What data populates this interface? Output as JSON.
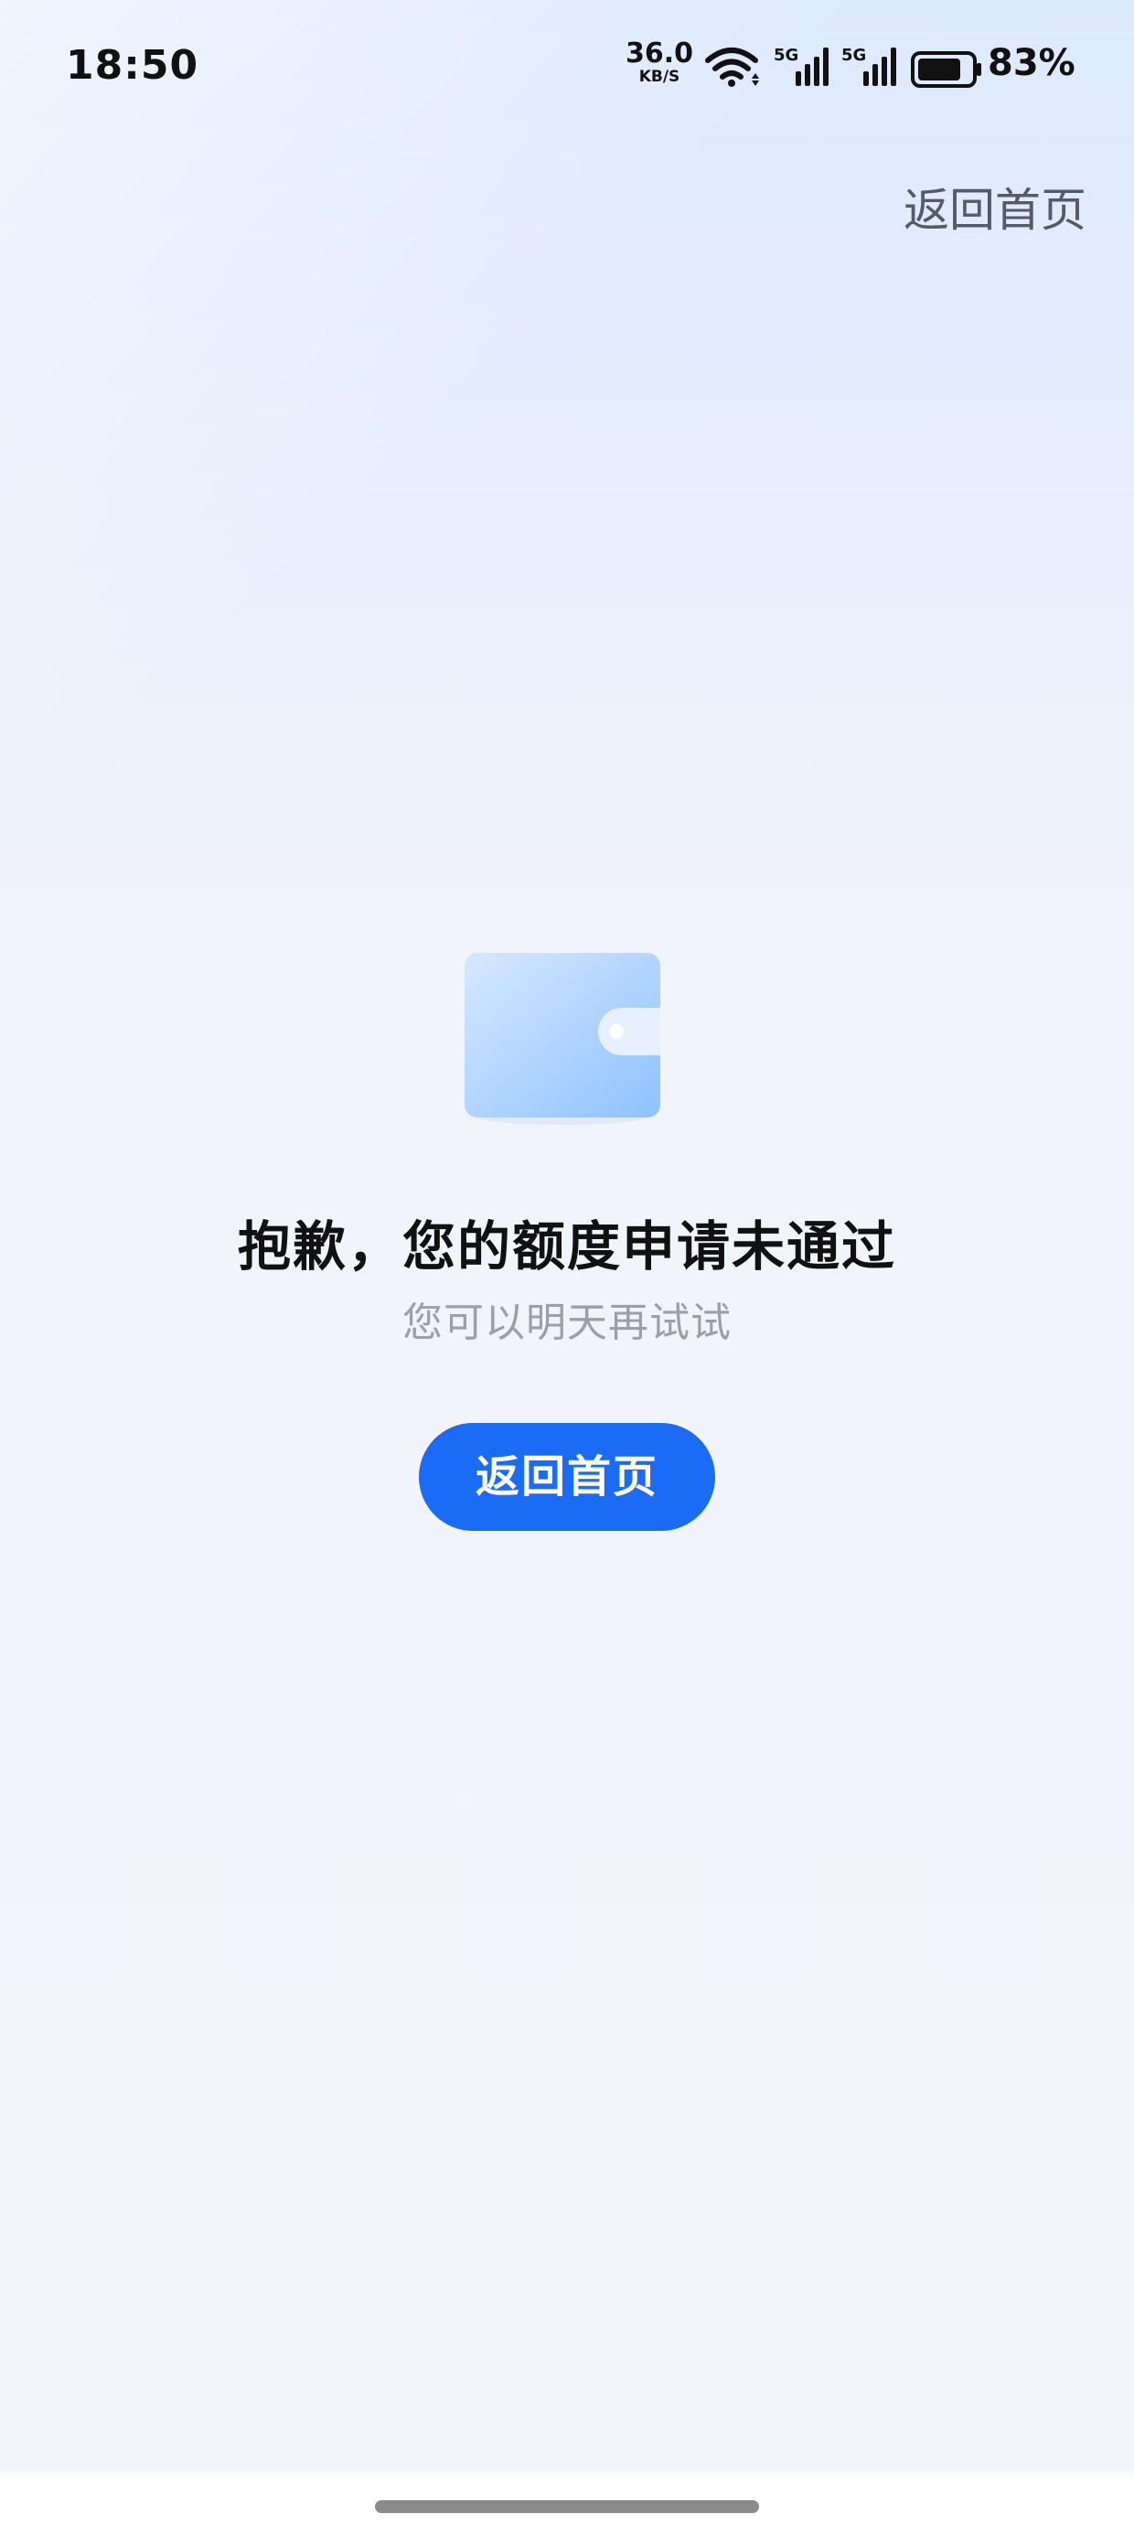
{
  "status_bar": {
    "time": "18:50",
    "net_speed_value": "36.0",
    "net_speed_unit": "KB/S",
    "signal_label": "5G",
    "battery_level": 0.83,
    "battery_percent": "83%"
  },
  "header": {
    "home_link_label": "返回首页"
  },
  "result": {
    "title": "抱歉，您的额度申请未通过",
    "subtitle": "您可以明天再试试",
    "button_label": "返回首页"
  },
  "colors": {
    "primary": "#1a6bf5",
    "wallet_light": "#cfe4ff",
    "wallet_dark": "#8ec2ff"
  }
}
